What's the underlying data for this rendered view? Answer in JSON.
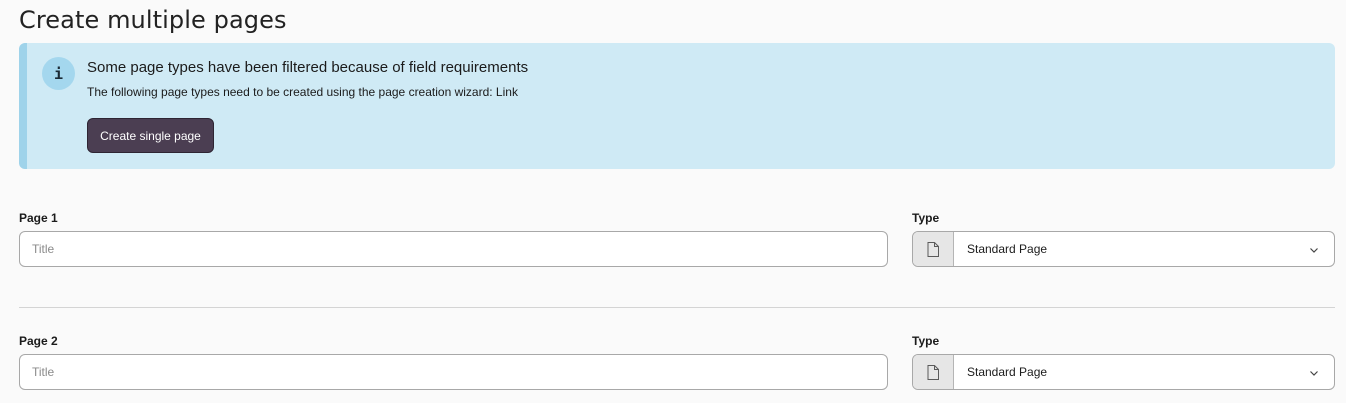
{
  "page": {
    "title": "Create multiple pages"
  },
  "alert": {
    "icon": "info-icon",
    "icon_glyph": "i",
    "heading": "Some page types have been filtered because of field requirements",
    "text": "The following page types need to be created using the page creation wizard: Link",
    "button_label": "Create single page"
  },
  "pages": [
    {
      "label": "Page 1",
      "title_value": "",
      "title_placeholder": "Title",
      "type_label": "Type",
      "type_value": "Standard Page",
      "type_icon": "document-icon"
    },
    {
      "label": "Page 2",
      "title_value": "",
      "title_placeholder": "Title",
      "type_label": "Type",
      "type_value": "Standard Page",
      "type_icon": "document-icon"
    }
  ],
  "colors": {
    "alert_background": "#cfeaf5",
    "alert_accent": "#9fd3ea",
    "primary_button": "#4b3e52"
  }
}
